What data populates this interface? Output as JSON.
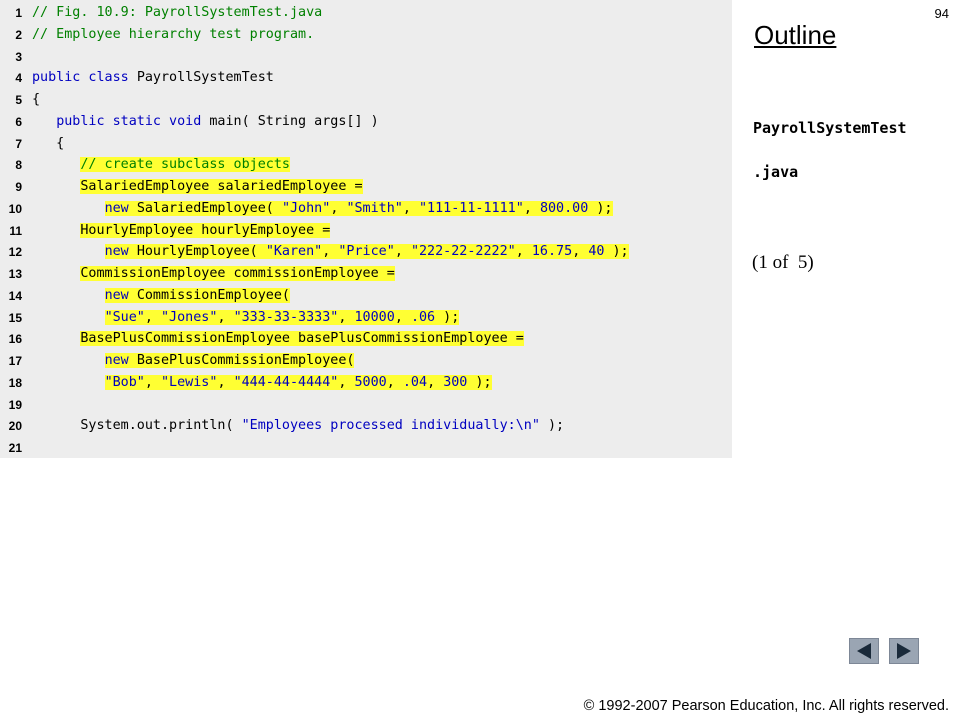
{
  "slide_number": "94",
  "outline": {
    "title": "Outline",
    "file_name_line1": "PayrollSystemTest",
    "file_name_line2": ".java",
    "part": "(1 of  5)"
  },
  "code_lines": [
    {
      "number": "1",
      "segments": [
        {
          "text": "// Fig. 10.9: PayrollSystemTest.java",
          "style": "cm"
        }
      ]
    },
    {
      "number": "2",
      "segments": [
        {
          "text": "// Employee hierarchy test program.",
          "style": "cm"
        }
      ]
    },
    {
      "number": "3",
      "segments": []
    },
    {
      "number": "4",
      "segments": [
        {
          "text": "public class ",
          "style": "kw"
        },
        {
          "text": "PayrollSystemTest",
          "style": "tx"
        }
      ]
    },
    {
      "number": "5",
      "segments": [
        {
          "text": "{",
          "style": "tx"
        }
      ]
    },
    {
      "number": "6",
      "segments": [
        {
          "text": "   ",
          "style": "tx"
        },
        {
          "text": "public static void ",
          "style": "kw"
        },
        {
          "text": "main( String args[] )",
          "style": "tx"
        }
      ]
    },
    {
      "number": "7",
      "segments": [
        {
          "text": "   {",
          "style": "tx"
        }
      ]
    },
    {
      "number": "8",
      "segments": [
        {
          "text": "      ",
          "style": "tx"
        },
        {
          "text": "// create subclass objects",
          "style": "cm",
          "hl": true
        }
      ]
    },
    {
      "number": "9",
      "segments": [
        {
          "text": "      ",
          "style": "tx"
        },
        {
          "text": "SalariedEmployee salariedEmployee =",
          "style": "tx",
          "hl": true
        }
      ]
    },
    {
      "number": "10",
      "segments": [
        {
          "text": "         ",
          "style": "tx"
        },
        {
          "text": "new ",
          "style": "kw",
          "hl": true
        },
        {
          "text": "SalariedEmployee( ",
          "style": "tx",
          "hl": true
        },
        {
          "text": "\"John\"",
          "style": "st",
          "hl": true
        },
        {
          "text": ", ",
          "style": "tx",
          "hl": true
        },
        {
          "text": "\"Smith\"",
          "style": "st",
          "hl": true
        },
        {
          "text": ", ",
          "style": "tx",
          "hl": true
        },
        {
          "text": "\"111-11-1111\"",
          "style": "st",
          "hl": true
        },
        {
          "text": ", ",
          "style": "tx",
          "hl": true
        },
        {
          "text": "800.00",
          "style": "st",
          "hl": true
        },
        {
          "text": " );",
          "style": "tx",
          "hl": true
        }
      ]
    },
    {
      "number": "11",
      "segments": [
        {
          "text": "      ",
          "style": "tx"
        },
        {
          "text": "HourlyEmployee hourlyEmployee =",
          "style": "tx",
          "hl": true
        }
      ]
    },
    {
      "number": "12",
      "segments": [
        {
          "text": "         ",
          "style": "tx"
        },
        {
          "text": "new ",
          "style": "kw",
          "hl": true
        },
        {
          "text": "HourlyEmployee( ",
          "style": "tx",
          "hl": true
        },
        {
          "text": "\"Karen\"",
          "style": "st",
          "hl": true
        },
        {
          "text": ", ",
          "style": "tx",
          "hl": true
        },
        {
          "text": "\"Price\"",
          "style": "st",
          "hl": true
        },
        {
          "text": ", ",
          "style": "tx",
          "hl": true
        },
        {
          "text": "\"222-22-2222\"",
          "style": "st",
          "hl": true
        },
        {
          "text": ", ",
          "style": "tx",
          "hl": true
        },
        {
          "text": "16.75",
          "style": "st",
          "hl": true
        },
        {
          "text": ", ",
          "style": "tx",
          "hl": true
        },
        {
          "text": "40",
          "style": "st",
          "hl": true
        },
        {
          "text": " );",
          "style": "tx",
          "hl": true
        }
      ]
    },
    {
      "number": "13",
      "segments": [
        {
          "text": "      ",
          "style": "tx"
        },
        {
          "text": "CommissionEmployee commissionEmployee =",
          "style": "tx",
          "hl": true
        }
      ]
    },
    {
      "number": "14",
      "segments": [
        {
          "text": "         ",
          "style": "tx"
        },
        {
          "text": "new ",
          "style": "kw",
          "hl": true
        },
        {
          "text": "CommissionEmployee(",
          "style": "tx",
          "hl": true
        }
      ]
    },
    {
      "number": "15",
      "segments": [
        {
          "text": "         ",
          "style": "tx"
        },
        {
          "text": "\"Sue\"",
          "style": "st",
          "hl": true
        },
        {
          "text": ", ",
          "style": "tx",
          "hl": true
        },
        {
          "text": "\"Jones\"",
          "style": "st",
          "hl": true
        },
        {
          "text": ", ",
          "style": "tx",
          "hl": true
        },
        {
          "text": "\"333-33-3333\"",
          "style": "st",
          "hl": true
        },
        {
          "text": ", ",
          "style": "tx",
          "hl": true
        },
        {
          "text": "10000",
          "style": "st",
          "hl": true
        },
        {
          "text": ", ",
          "style": "tx",
          "hl": true
        },
        {
          "text": ".06",
          "style": "st",
          "hl": true
        },
        {
          "text": " );",
          "style": "tx",
          "hl": true
        }
      ]
    },
    {
      "number": "16",
      "segments": [
        {
          "text": "      ",
          "style": "tx"
        },
        {
          "text": "BasePlusCommissionEmployee basePlusCommissionEmployee =",
          "style": "tx",
          "hl": true
        }
      ]
    },
    {
      "number": "17",
      "segments": [
        {
          "text": "         ",
          "style": "tx"
        },
        {
          "text": "new ",
          "style": "kw",
          "hl": true
        },
        {
          "text": "BasePlusCommissionEmployee(",
          "style": "tx",
          "hl": true
        }
      ]
    },
    {
      "number": "18",
      "segments": [
        {
          "text": "         ",
          "style": "tx"
        },
        {
          "text": "\"Bob\"",
          "style": "st",
          "hl": true
        },
        {
          "text": ", ",
          "style": "tx",
          "hl": true
        },
        {
          "text": "\"Lewis\"",
          "style": "st",
          "hl": true
        },
        {
          "text": ", ",
          "style": "tx",
          "hl": true
        },
        {
          "text": "\"444-44-4444\"",
          "style": "st",
          "hl": true
        },
        {
          "text": ", ",
          "style": "tx",
          "hl": true
        },
        {
          "text": "5000",
          "style": "st",
          "hl": true
        },
        {
          "text": ", ",
          "style": "tx",
          "hl": true
        },
        {
          "text": ".04",
          "style": "st",
          "hl": true
        },
        {
          "text": ", ",
          "style": "tx",
          "hl": true
        },
        {
          "text": "300",
          "style": "st",
          "hl": true
        },
        {
          "text": " );",
          "style": "tx",
          "hl": true
        }
      ]
    },
    {
      "number": "19",
      "segments": []
    },
    {
      "number": "20",
      "segments": [
        {
          "text": "      System.out.println( ",
          "style": "tx"
        },
        {
          "text": "\"Employees processed individually:\\n\"",
          "style": "st"
        },
        {
          "text": " );",
          "style": "tx"
        }
      ]
    },
    {
      "number": "21",
      "segments": []
    }
  ],
  "nav": {
    "back_icon": "triangle-left-icon",
    "forward_icon": "triangle-right-icon"
  },
  "copyright": "© 1992-2007 Pearson Education, Inc.  All rights reserved.",
  "colors": {
    "keyword": "#0000c0",
    "comment": "#008000",
    "highlight": "#ffff33",
    "code_background": "#ededed",
    "nav_button": "#9aa5b3"
  }
}
